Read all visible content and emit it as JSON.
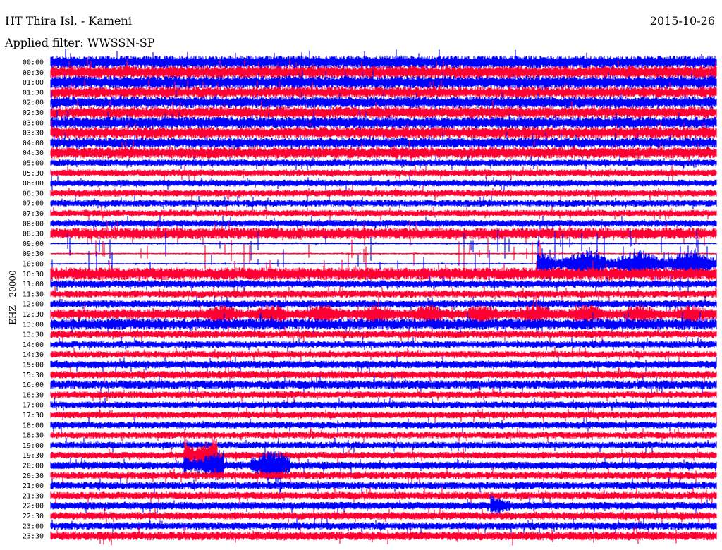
{
  "header": {
    "station": "HT Thira Isl. - Kameni",
    "date": "2015-10-26",
    "filter": "Applied filter: WWSSN-SP"
  },
  "chart_data": {
    "type": "line",
    "title": "HT Thira Isl. - Kameni",
    "subtitle": "Applied filter: WWSSN-SP",
    "ylabel": "EHZ - 20000",
    "colors": [
      "#0000ff",
      "#ff0033"
    ],
    "row_labels": [
      "00:00",
      "00:30",
      "01:00",
      "01:30",
      "02:00",
      "02:30",
      "03:00",
      "03:30",
      "04:00",
      "04:30",
      "05:00",
      "05:30",
      "06:00",
      "06:30",
      "07:00",
      "07:30",
      "08:00",
      "08:30",
      "09:00",
      "09:30",
      "10:00",
      "10:30",
      "11:00",
      "11:30",
      "12:00",
      "12:30",
      "13:00",
      "13:30",
      "14:00",
      "14:30",
      "15:00",
      "15:30",
      "16:00",
      "16:30",
      "17:00",
      "17:30",
      "18:00",
      "18:30",
      "19:00",
      "19:30",
      "20:00",
      "20:30",
      "21:00",
      "21:30",
      "22:00",
      "22:30",
      "23:00",
      "23:30"
    ],
    "relative_noise_amplitude": [
      1.0,
      1.0,
      1.0,
      0.9,
      0.9,
      0.9,
      0.9,
      0.9,
      0.8,
      0.9,
      0.55,
      0.55,
      0.55,
      0.55,
      0.55,
      0.55,
      0.55,
      0.9,
      0.12,
      0.12,
      0.12,
      1.0,
      0.6,
      0.6,
      0.6,
      0.8,
      0.9,
      0.6,
      0.55,
      0.55,
      0.6,
      0.6,
      0.7,
      0.55,
      0.55,
      0.55,
      0.55,
      0.55,
      0.55,
      0.55,
      0.6,
      0.6,
      0.6,
      0.6,
      0.6,
      0.6,
      0.6,
      0.7
    ],
    "events": [
      {
        "row": "10:00",
        "start_fraction": 0.73,
        "end_fraction": 1.0,
        "amplitude": 2.2
      },
      {
        "row": "19:30",
        "start_fraction": 0.2,
        "end_fraction": 0.25,
        "amplitude": 3.5
      },
      {
        "row": "20:00",
        "start_fraction": 0.2,
        "end_fraction": 0.26,
        "amplitude": 2.5
      },
      {
        "row": "20:00",
        "start_fraction": 0.3,
        "end_fraction": 0.36,
        "amplitude": 2.5
      },
      {
        "row": "22:00",
        "start_fraction": 0.66,
        "end_fraction": 0.69,
        "amplitude": 2.2
      },
      {
        "row": "12:30",
        "start_fraction": 0.23,
        "end_fraction": 1.0,
        "amplitude": 1.5
      }
    ]
  }
}
